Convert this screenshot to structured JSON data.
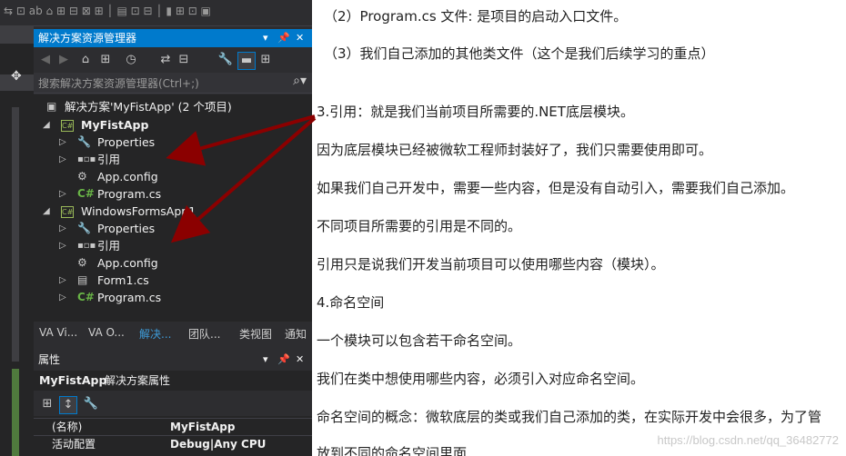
{
  "solution_explorer": {
    "title": "解决方案资源管理器",
    "search_placeholder": "搜索解决方案资源管理器(Ctrl+;)",
    "solution_label": "解决方案'MyFistApp' (2 个项目)",
    "projects": [
      {
        "name": "MyFistApp",
        "items": [
          "Properties",
          "引用",
          "App.config",
          "Program.cs"
        ]
      },
      {
        "name": "WindowsFormsApp1",
        "items": [
          "Properties",
          "引用",
          "App.config",
          "Form1.cs",
          "Program.cs"
        ]
      }
    ],
    "tabs": [
      "VA Vi...",
      "VA O...",
      "解决...",
      "团队...",
      "类视图",
      "通知"
    ]
  },
  "properties": {
    "title": "属性",
    "object_name": "MyFistApp",
    "object_type": "解决方案属性",
    "rows": [
      {
        "key": "(名称)",
        "value": "MyFistApp"
      },
      {
        "key": "活动配置",
        "value": "Debug|Any CPU"
      }
    ]
  },
  "document": {
    "lines": [
      "（2）Program.cs 文件: 是项目的启动入口文件。",
      "（3）我们自己添加的其他类文件（这个是我们后续学习的重点）",
      "3.引用：就是我们当前项目所需要的.NET底层模块。",
      "因为底层模块已经被微软工程师封装好了，我们只需要使用即可。",
      "如果我们自己开发中，需要一些内容，但是没有自动引入，需要我们自己添加。",
      "不同项目所需要的引用是不同的。",
      "引用只是说我们开发当前项目可以使用哪些内容（模块）。",
      "4.命名空间",
      "一个模块可以包含若干命名空间。",
      "我们在类中想使用哪些内容，必须引入对应命名空间。",
      "命名空间的概念：微软底层的类或我们自己添加的类，在实际开发中会很多，为了管",
      "放到不同的命名空间里面"
    ],
    "watermark": "https://blog.csdn.net/qq_36482772"
  },
  "colors": {
    "accent": "#007acc",
    "annotation_arrow": "#8b0000"
  }
}
